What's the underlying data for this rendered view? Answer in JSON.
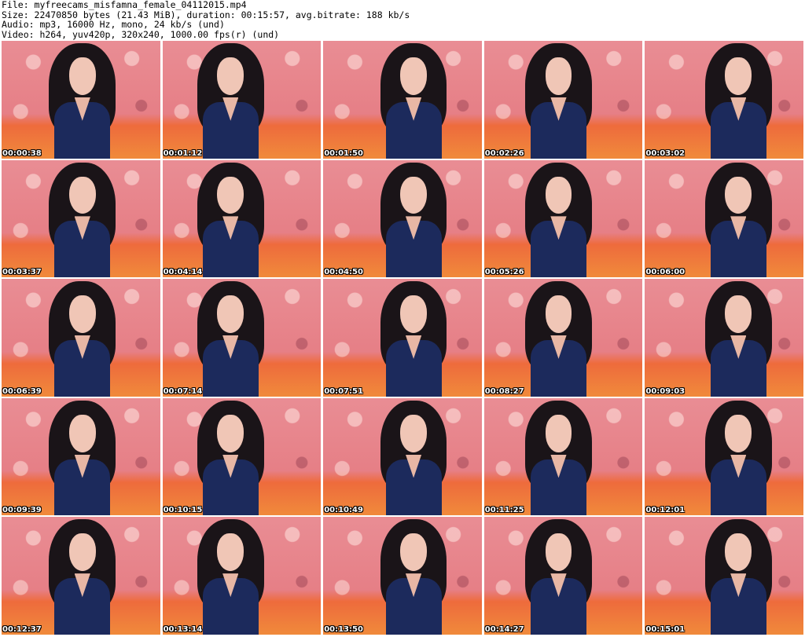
{
  "header": {
    "file": "File: myfreecams_misfamna_female_04112015.mp4",
    "size": "Size: 22470850 bytes (21.43 MiB), duration: 00:15:57, avg.bitrate: 188 kb/s",
    "audio": "Audio: mp3, 16000 Hz, mono, 24 kb/s (und)",
    "video": "Video: h264, yuv420p, 320x240, 1000.00 fps(r) (und)"
  },
  "timestamps": [
    "00:00:38",
    "00:01:12",
    "00:01:50",
    "00:02:26",
    "00:03:02",
    "00:03:37",
    "00:04:14",
    "00:04:50",
    "00:05:26",
    "00:06:00",
    "00:06:39",
    "00:07:14",
    "00:07:51",
    "00:08:27",
    "00:09:03",
    "00:09:39",
    "00:10:15",
    "00:10:49",
    "00:11:25",
    "00:12:01",
    "00:12:37",
    "00:13:14",
    "00:13:50",
    "00:14:27",
    "00:15:01"
  ]
}
